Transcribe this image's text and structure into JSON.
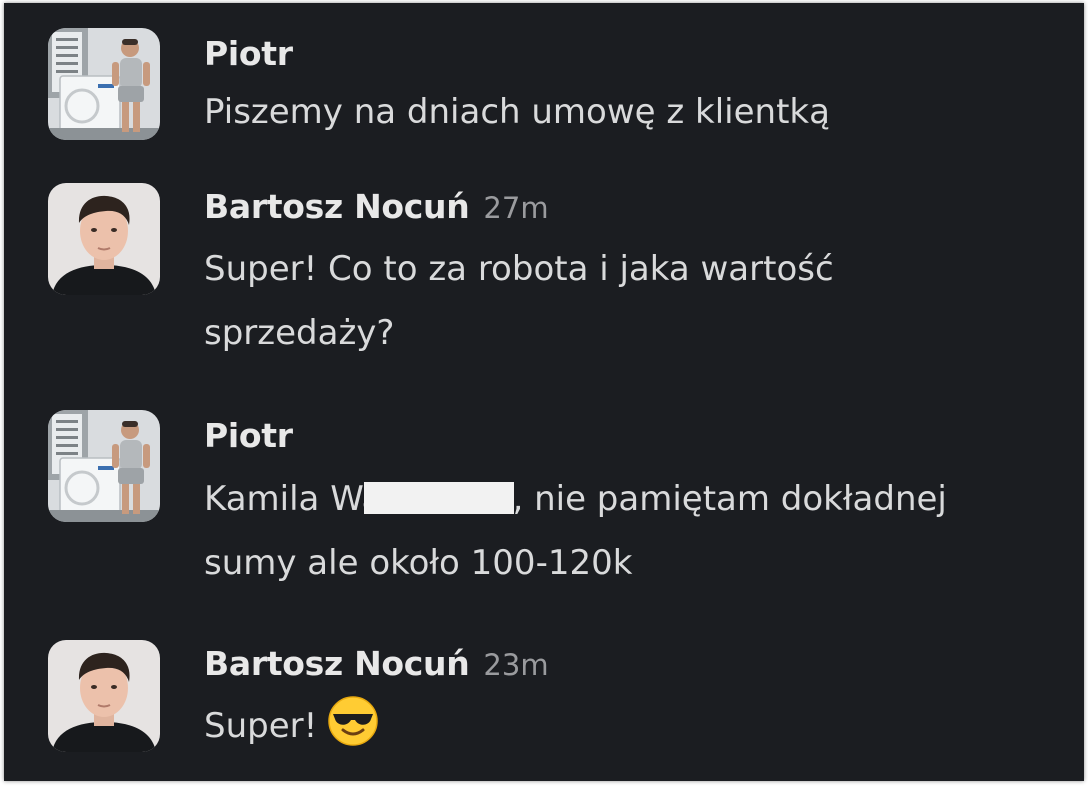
{
  "messages": [
    {
      "author": "Piotr",
      "time": "",
      "text": "Piszemy na dniach umowę z klientką",
      "avatar": "man-with-ac-unit-avatar"
    },
    {
      "author": "Bartosz Nocuń",
      "time": "27m",
      "text": "Super! Co to za robota i jaka wartość\nsprzedaży?",
      "avatar": "man-portrait-avatar"
    },
    {
      "author": "Piotr",
      "time": "",
      "text_before": "Kamila Wa",
      "text_after": ", nie pamiętam dokładnej\nsumy ale około 100-120k",
      "avatar": "man-with-ac-unit-avatar"
    },
    {
      "author": "Bartosz Nocuń",
      "time": "23m",
      "text": "Super!",
      "emoji": "sunglasses-emoji",
      "avatar": "man-portrait-avatar"
    }
  ],
  "colors": {
    "background": "#1b1d21",
    "text": "#d9dadb",
    "timestamp": "#9a9b9e",
    "redaction": "#f2f2f2"
  }
}
